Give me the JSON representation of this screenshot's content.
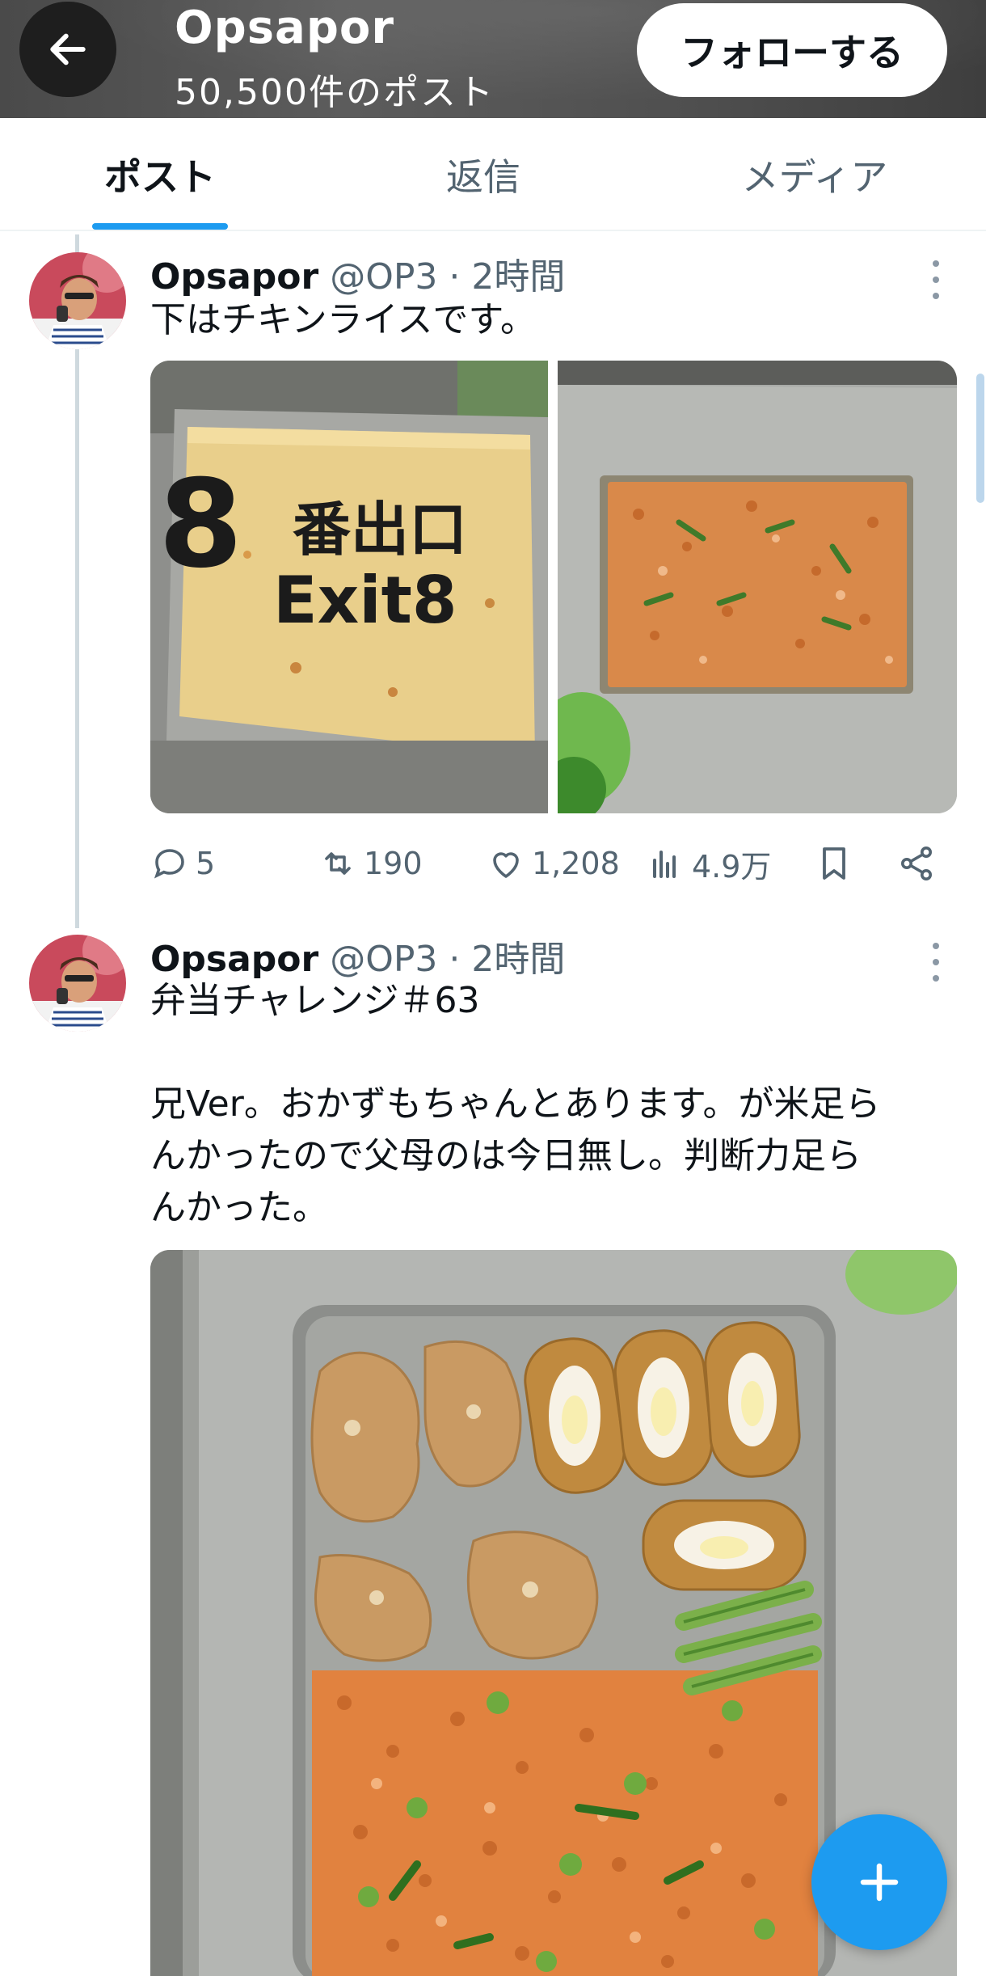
{
  "header": {
    "title": "Opsapor",
    "subtitle": "50,500件のポスト",
    "follow_label": "フォローする"
  },
  "tabs": [
    {
      "label": "ポスト",
      "active": true
    },
    {
      "label": "返信",
      "active": false
    },
    {
      "label": "メディア",
      "active": false
    }
  ],
  "posts": [
    {
      "name": "Opsapor",
      "handle_time": "@OP3 · 2時間",
      "text": "下はチキンライスです。",
      "image_overlay": {
        "line1_num": "8",
        "line1_text": "番出口",
        "line2_text": "Exit8"
      },
      "actions": {
        "replies": "5",
        "reposts": "190",
        "likes": "1,208",
        "views": "4.9万"
      }
    },
    {
      "name": "Opsapor",
      "handle_time": "@OP3 · 2時間",
      "text": "弁当チャレンジ＃63\n\n兄Ver。おかずもちゃんとあります。が米足ら\nんかったので父母のは今日無し。判断力足ら\nんかった。"
    }
  ],
  "colors": {
    "accent": "#1d9bf0",
    "text_secondary": "#536471",
    "header_bg": "#4f4f4f"
  },
  "icons": [
    "back-arrow-icon",
    "more-icon",
    "reply-icon",
    "repost-icon",
    "like-icon",
    "views-icon",
    "bookmark-icon",
    "share-icon",
    "plus-icon"
  ]
}
